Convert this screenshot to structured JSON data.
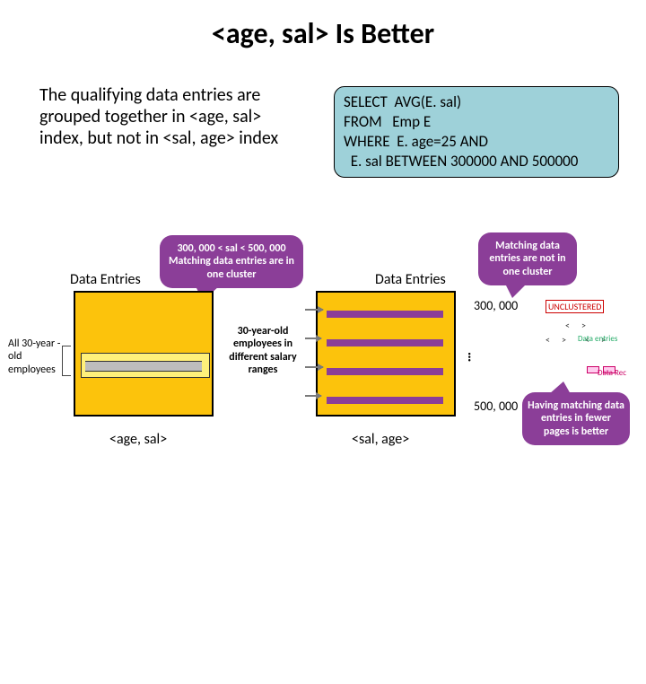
{
  "title": "<age, sal> Is Better",
  "intro": "The qualifying data entries are grouped together in <age, sal> index, but not in <sal, age> index",
  "sql": {
    "select": "SELECT",
    "select_arg": "AVG(E. sal)",
    "from": "FROM",
    "from_arg": "Emp E",
    "where": "WHERE",
    "where_cond1": "E. age=25",
    "and": "AND",
    "between_field": "E. sal",
    "between_kw": "BETWEEN",
    "between_lo": "300000",
    "and2": "AND",
    "between_hi": "500000"
  },
  "callouts": {
    "c1": "300, 000 < sal < 500, 000 Matching data entries are in one cluster",
    "c2": "Matching data entries are not in one cluster",
    "c3": "Having matching data entries in fewer pages is better",
    "c4": "30-year-old employees in different salary ranges"
  },
  "labels": {
    "data_entries": "Data Entries",
    "all30": "All 30-year -old employees",
    "idx_left": "<age, sal>",
    "idx_right": "<sal, age>",
    "val300": "300, 000",
    "val500": "500, 000",
    "unclustered": "UNCLUSTERED",
    "data_entries_small": "Data entries",
    "data_rec": "Data Rec"
  }
}
